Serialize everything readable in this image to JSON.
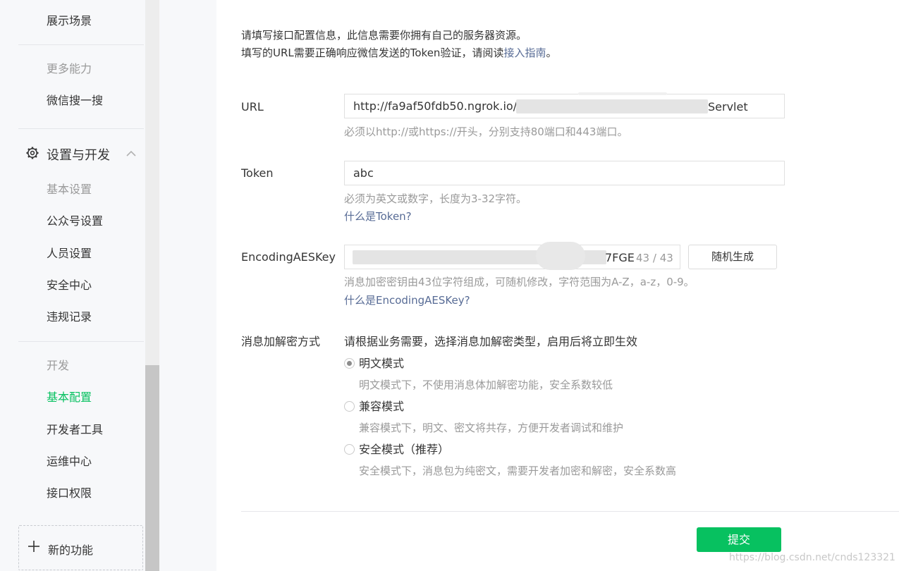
{
  "sidebar": {
    "items": [
      {
        "label": "展示场景",
        "state": "normal"
      },
      {
        "label": "更多能力",
        "state": "muted"
      },
      {
        "label": "微信搜一搜",
        "state": "normal"
      }
    ],
    "section": {
      "label": "设置与开发",
      "icon": "gear-icon"
    },
    "settings_items": [
      {
        "label": "基本设置",
        "state": "muted"
      },
      {
        "label": "公众号设置",
        "state": "normal"
      },
      {
        "label": "人员设置",
        "state": "normal"
      },
      {
        "label": "安全中心",
        "state": "normal"
      },
      {
        "label": "违规记录",
        "state": "normal"
      }
    ],
    "dev_items": [
      {
        "label": "开发",
        "state": "muted"
      },
      {
        "label": "基本配置",
        "state": "active"
      },
      {
        "label": "开发者工具",
        "state": "normal"
      },
      {
        "label": "运维中心",
        "state": "normal"
      },
      {
        "label": "接口权限",
        "state": "normal"
      }
    ],
    "new_feature": "新的功能"
  },
  "intro": {
    "line1": "请填写接口配置信息，此信息需要你拥有自己的服务器资源。",
    "line2_prefix": "填写的URL需要正确响应微信发送的Token验证，请阅读",
    "line2_link": "接入指南",
    "line2_suffix": "。"
  },
  "form": {
    "url": {
      "label": "URL",
      "value_start": "http://fa9af50fdb50.ngrok.io/D",
      "value_end": "Servlet",
      "hint": "必须以http://或https://开头，分别支持80端口和443端口。"
    },
    "token": {
      "label": "Token",
      "value": "abc",
      "hint": "必须为英文或数字，长度为3-32字符。",
      "link": "什么是Token?"
    },
    "aeskey": {
      "label": "EncodingAESKey",
      "value_end": "7FGE",
      "count": "43",
      "max": "43",
      "random_button": "随机生成",
      "hint": "消息加密密钥由43位字符组成，可随机修改，字符范围为A-Z，a-z，0-9。",
      "link": "什么是EncodingAESKey?"
    },
    "mode": {
      "label": "消息加解密方式",
      "description": "请根据业务需要，选择消息加解密类型，启用后将立即生效",
      "options": [
        {
          "label": "明文模式",
          "desc": "明文模式下，不使用消息体加解密功能，安全系数较低",
          "checked": true
        },
        {
          "label": "兼容模式",
          "desc": "兼容模式下，明文、密文将共存，方便开发者调试和维护",
          "checked": false
        },
        {
          "label": "安全模式（推荐）",
          "desc": "安全模式下，消息包为纯密文，需要开发者加密和解密，安全系数高",
          "checked": false
        }
      ]
    },
    "submit": "提交"
  },
  "watermark": "https://blog.csdn.net/cnds123321",
  "colors": {
    "accent": "#07c160",
    "link": "#576b95",
    "muted": "#9a9a9a"
  }
}
